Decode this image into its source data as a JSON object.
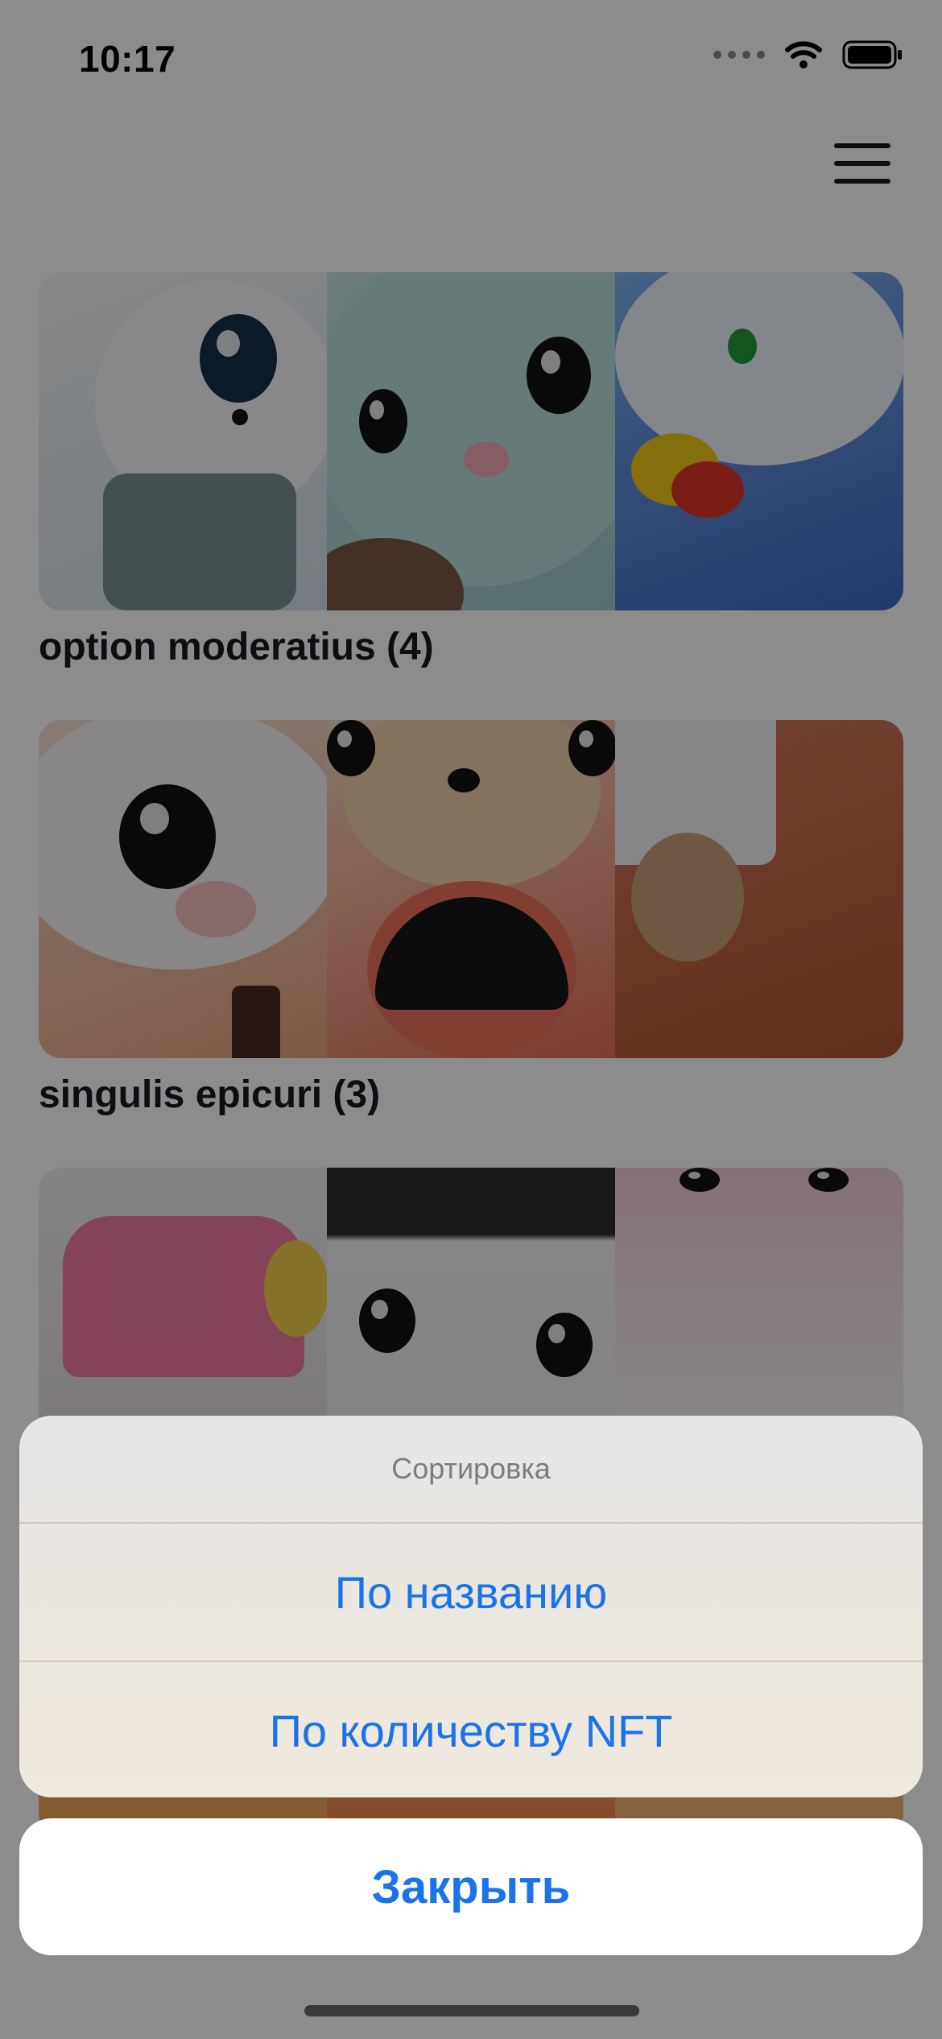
{
  "status_bar": {
    "time": "10:17"
  },
  "collections": [
    {
      "title": "option moderatius (4)"
    },
    {
      "title": "singulis epicuri (3)"
    },
    {
      "title": ""
    }
  ],
  "sort_sheet": {
    "title": "Сортировка",
    "options": [
      "По названию",
      "По количеству NFT"
    ],
    "close_label": "Закрыть"
  },
  "colors": {
    "accent": "#1a73e8",
    "text_dark": "#1a1b22"
  }
}
